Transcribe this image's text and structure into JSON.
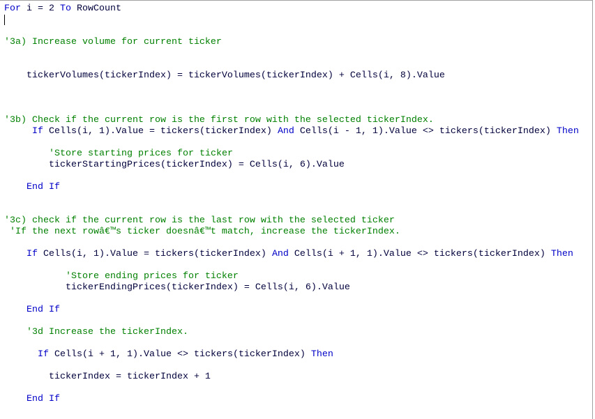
{
  "lines": [
    {
      "tokens": [
        {
          "t": "kw",
          "text": "For"
        },
        {
          "t": "pl",
          "text": " i = 2 "
        },
        {
          "t": "kw",
          "text": "To"
        },
        {
          "t": "pl",
          "text": " RowCount"
        }
      ]
    },
    {
      "tokens": []
    },
    {
      "tokens": []
    },
    {
      "tokens": [
        {
          "t": "cm",
          "text": "'3a) Increase volume for current ticker"
        }
      ]
    },
    {
      "tokens": []
    },
    {
      "tokens": []
    },
    {
      "tokens": [
        {
          "t": "pl",
          "text": "    tickerVolumes(tickerIndex) = tickerVolumes(tickerIndex) + Cells(i, 8).Value"
        }
      ]
    },
    {
      "tokens": []
    },
    {
      "tokens": []
    },
    {
      "tokens": []
    },
    {
      "tokens": [
        {
          "t": "cm",
          "text": "'3b) Check if the current row is the first row with the selected tickerIndex."
        }
      ]
    },
    {
      "tokens": [
        {
          "t": "pl",
          "text": "     "
        },
        {
          "t": "kw",
          "text": "If"
        },
        {
          "t": "pl",
          "text": " Cells(i, 1).Value = tickers(tickerIndex) "
        },
        {
          "t": "kw",
          "text": "And"
        },
        {
          "t": "pl",
          "text": " Cells(i - 1, 1).Value <> tickers(tickerIndex) "
        },
        {
          "t": "kw",
          "text": "Then"
        }
      ]
    },
    {
      "tokens": []
    },
    {
      "tokens": [
        {
          "t": "pl",
          "text": "        "
        },
        {
          "t": "cm",
          "text": "'Store starting prices for ticker"
        }
      ]
    },
    {
      "tokens": [
        {
          "t": "pl",
          "text": "        tickerStartingPrices(tickerIndex) = Cells(i, 6).Value"
        }
      ]
    },
    {
      "tokens": []
    },
    {
      "tokens": [
        {
          "t": "pl",
          "text": "    "
        },
        {
          "t": "kw",
          "text": "End If"
        }
      ]
    },
    {
      "tokens": []
    },
    {
      "tokens": []
    },
    {
      "tokens": [
        {
          "t": "cm",
          "text": "'3c) check if the current row is the last row with the selected ticker"
        }
      ]
    },
    {
      "tokens": [
        {
          "t": "pl",
          "text": " "
        },
        {
          "t": "cm",
          "text": "'If the next rowâ€™s ticker doesnâ€™t match, increase the tickerIndex."
        }
      ]
    },
    {
      "tokens": []
    },
    {
      "tokens": [
        {
          "t": "pl",
          "text": "    "
        },
        {
          "t": "kw",
          "text": "If"
        },
        {
          "t": "pl",
          "text": " Cells(i, 1).Value = tickers(tickerIndex) "
        },
        {
          "t": "kw",
          "text": "And"
        },
        {
          "t": "pl",
          "text": " Cells(i + 1, 1).Value <> tickers(tickerIndex) "
        },
        {
          "t": "kw",
          "text": "Then"
        }
      ]
    },
    {
      "tokens": []
    },
    {
      "tokens": [
        {
          "t": "pl",
          "text": "           "
        },
        {
          "t": "cm",
          "text": "'Store ending prices for ticker"
        }
      ]
    },
    {
      "tokens": [
        {
          "t": "pl",
          "text": "           tickerEndingPrices(tickerIndex) = Cells(i, 6).Value"
        }
      ]
    },
    {
      "tokens": []
    },
    {
      "tokens": [
        {
          "t": "pl",
          "text": "    "
        },
        {
          "t": "kw",
          "text": "End If"
        }
      ]
    },
    {
      "tokens": []
    },
    {
      "tokens": [
        {
          "t": "pl",
          "text": "    "
        },
        {
          "t": "cm",
          "text": "'3d Increase the tickerIndex."
        }
      ]
    },
    {
      "tokens": []
    },
    {
      "tokens": [
        {
          "t": "pl",
          "text": "      "
        },
        {
          "t": "kw",
          "text": "If"
        },
        {
          "t": "pl",
          "text": " Cells(i + 1, 1).Value <> tickers(tickerIndex) "
        },
        {
          "t": "kw",
          "text": "Then"
        }
      ]
    },
    {
      "tokens": []
    },
    {
      "tokens": [
        {
          "t": "pl",
          "text": "        tickerIndex = tickerIndex + 1"
        }
      ]
    },
    {
      "tokens": []
    },
    {
      "tokens": [
        {
          "t": "pl",
          "text": "    "
        },
        {
          "t": "kw",
          "text": "End If"
        }
      ]
    }
  ],
  "colors": {
    "keyword": "#0000c8",
    "comment": "#008000",
    "text": "#00003c"
  }
}
